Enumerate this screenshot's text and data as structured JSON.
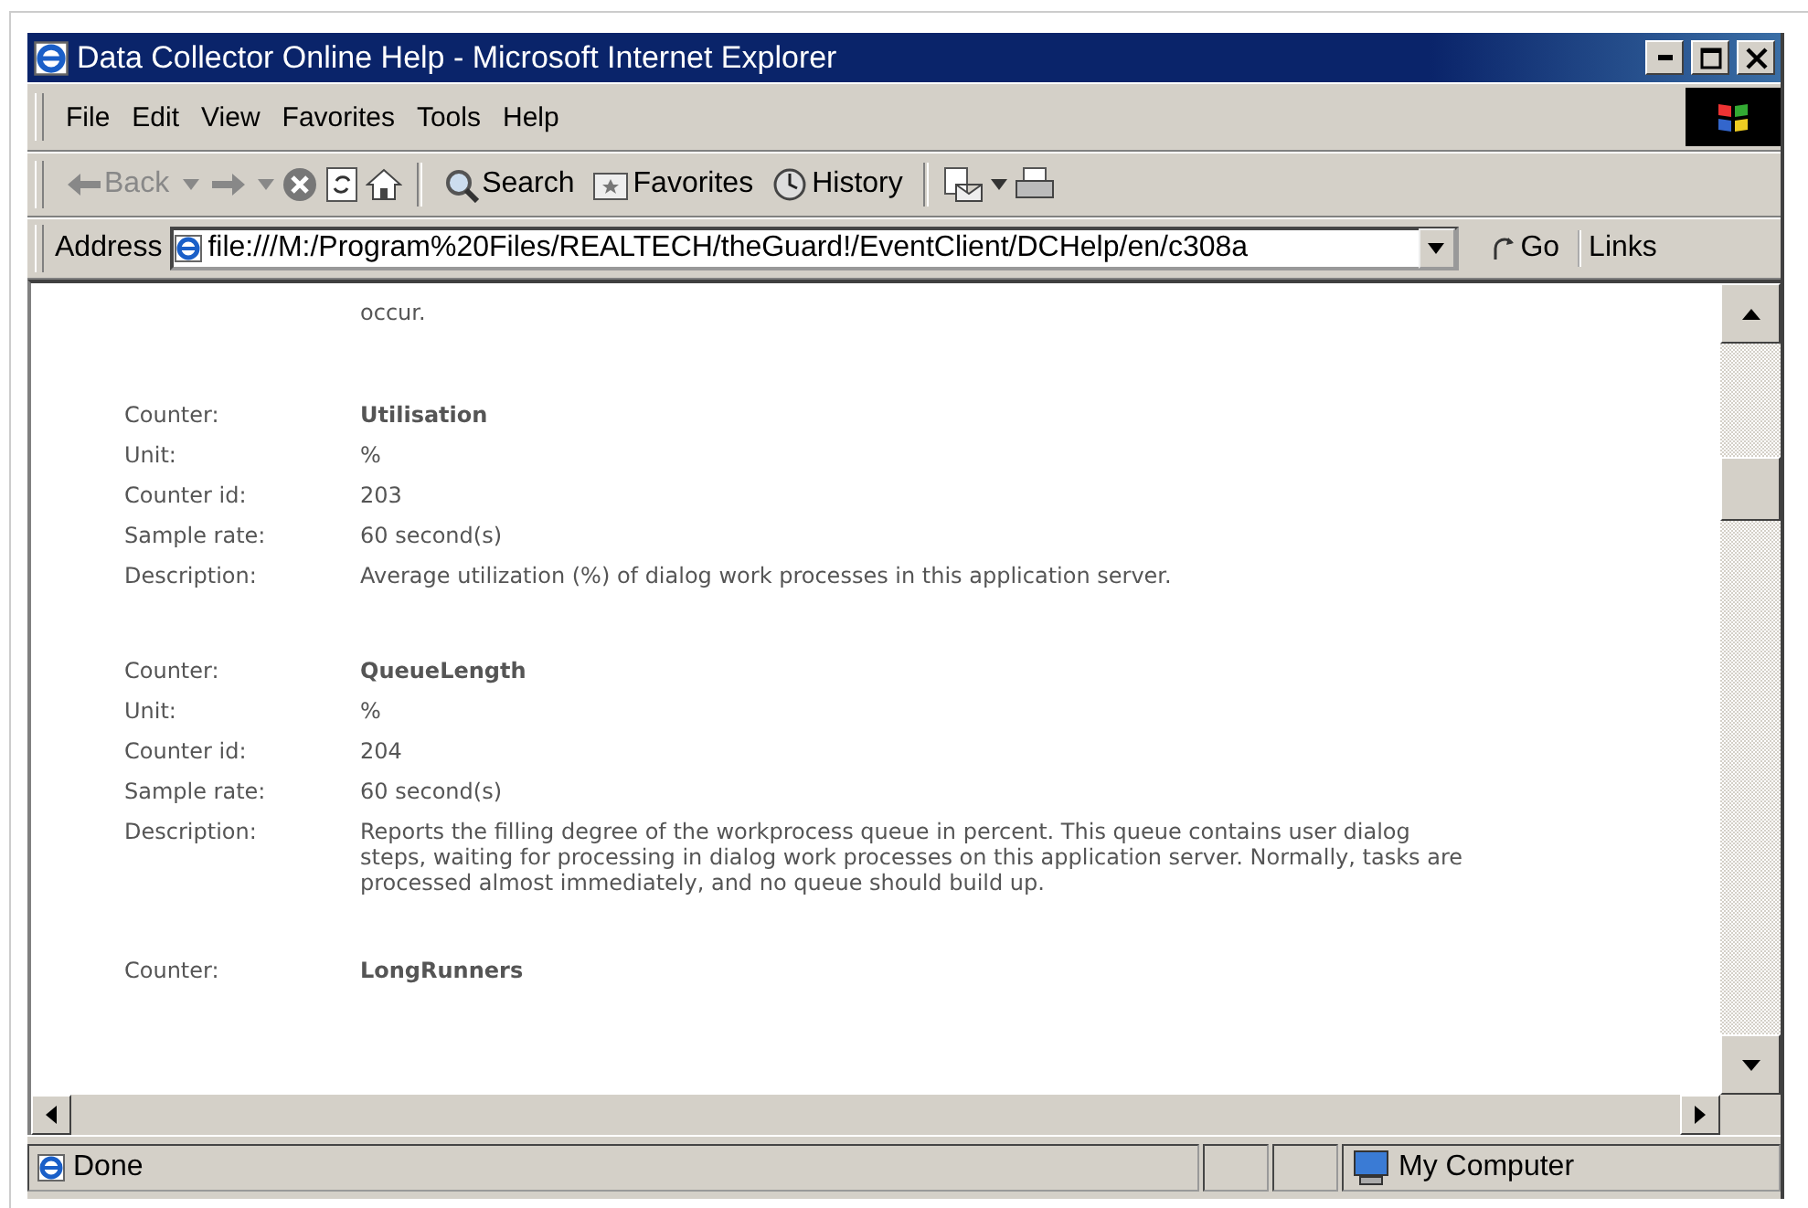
{
  "window": {
    "title": "Data Collector Online Help - Microsoft Internet Explorer"
  },
  "menu": [
    {
      "label": "File"
    },
    {
      "label": "Edit"
    },
    {
      "label": "View"
    },
    {
      "label": "Favorites"
    },
    {
      "label": "Tools"
    },
    {
      "label": "Help"
    }
  ],
  "toolbar": [
    {
      "kind": "back",
      "label": "Back",
      "disabled": true
    },
    {
      "kind": "forward",
      "disabled": true
    },
    {
      "kind": "stop"
    },
    {
      "kind": "refresh"
    },
    {
      "kind": "home"
    },
    {
      "kind": "separator"
    },
    {
      "kind": "search",
      "label": "Search"
    },
    {
      "kind": "favorites",
      "label": "Favorites"
    },
    {
      "kind": "history",
      "label": "History"
    },
    {
      "kind": "separator"
    },
    {
      "kind": "mail"
    },
    {
      "kind": "print"
    }
  ],
  "address": {
    "label": "Address",
    "value": "file:///M:/Program%20Files/REALTECH/theGuard!/EventClient/DCHelp/en/c308a",
    "go": "Go",
    "links": "Links"
  },
  "content": {
    "lead_text": "occur.",
    "counters": [
      {
        "fields": [
          {
            "label": "Counter:",
            "value": "Utilisation",
            "kind": "name"
          },
          {
            "label": "Unit:",
            "value": "%",
            "kind": "text"
          },
          {
            "label": "Counter id:",
            "value": "203",
            "kind": "text"
          },
          {
            "label": "Sample rate:",
            "value": "60 second(s)",
            "kind": "text"
          },
          {
            "label": "Description:",
            "value": "Average utilization (%) of dialog work processes in this application server.",
            "kind": "text"
          }
        ]
      },
      {
        "fields": [
          {
            "label": "Counter:",
            "value": "QueueLength",
            "kind": "name"
          },
          {
            "label": "Unit:",
            "value": "%",
            "kind": "text"
          },
          {
            "label": "Counter id:",
            "value": "204",
            "kind": "text"
          },
          {
            "label": "Sample rate:",
            "value": "60 second(s)",
            "kind": "text"
          },
          {
            "label": "Description:",
            "value": "Reports the filling degree of the workprocess queue in percent. This queue contains user dialog steps, waiting for processing in dialog work processes on this application server. Normally, tasks are processed almost immediately, and no queue should build up.",
            "kind": "text"
          }
        ]
      },
      {
        "fields": [
          {
            "label": "Counter:",
            "value": "LongRunners",
            "kind": "name"
          }
        ]
      }
    ]
  },
  "status_bar": {
    "text": "Done",
    "zone": "My Computer"
  }
}
